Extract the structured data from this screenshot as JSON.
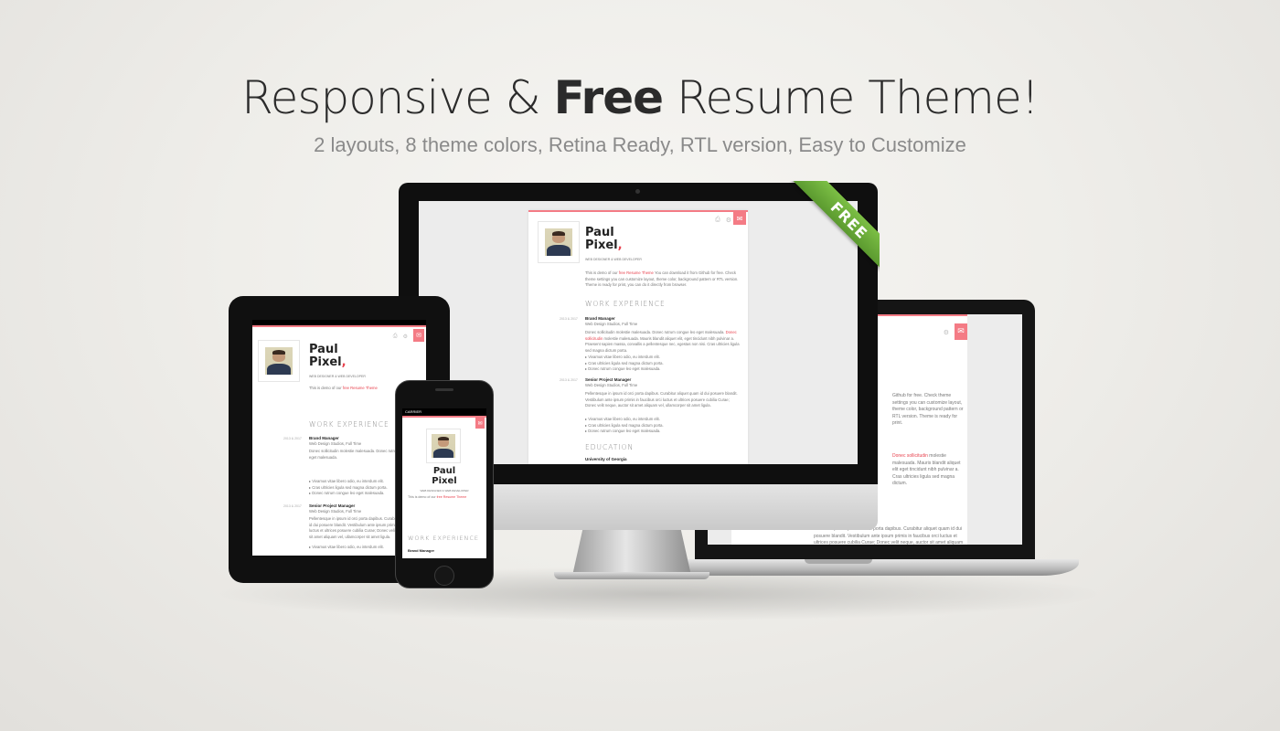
{
  "header": {
    "headline_pre": "Responsive &",
    "headline_bold": "Free",
    "headline_post": "Resume Theme!",
    "subline": "2 layouts, 8 theme colors, Retina Ready, RTL version, Easy to Customize"
  },
  "badge": {
    "text": "FREE",
    "color": "#6aa83a"
  },
  "accent_color": "#e8434f",
  "resume": {
    "name_first": "Paul",
    "name_last": "Pixel",
    "comma": ",",
    "role": "WEB DESIGNER & WEB DEVELOPER",
    "intro_pre": "This is demo of our",
    "intro_link": "free Resume Theme",
    "intro_post": "You can download it from Github for free. Check theme settings you can customize layout, theme color, background pattern or RTL version. Theme is ready for print, you can do it directly from browser.",
    "work_title": "WORK EXPERIENCE",
    "education_title": "EDUCATION",
    "jobs": [
      {
        "date": "2013 & 2017",
        "title": "Brand Manager",
        "company": "Web Design Studios, Full Time",
        "desc_pre": "Donec sollicitudin molestie malesuada. Donec rutrum congue leo eget malesuada.",
        "desc_link": "Donec sollicitudin",
        "desc_post": "molestie malesuada. Mauris blandit aliquet elit, eget tincidunt nibh pulvinar a. Praesent sapien massa, convallis a pellentesque nec, egestas non nisi. Cras ultricies ligula sed magna dictum porta.",
        "bullets": [
          "Vivamus vitae libero odio, eu interdum elit.",
          "Cras ultricies ligula sed magna dictum porta.",
          "Donec rutrum congue leo eget malesuada."
        ]
      },
      {
        "date": "2013 & 2017",
        "title": "Senior Project Manager",
        "company": "Web Design Studios, Full Time",
        "desc_pre": "Pellentesque in ipsum id orci porta dapibus. Curabitur aliquet quam id dui posuere blandit. Vestibulum ante ipsum primis in faucibus orci luctus et ultrices posuere cubilia Curae; Donec velit neque, auctor sit amet aliquam vel, ullamcorper sit amet ligula.",
        "desc_link": "",
        "desc_post": "",
        "bullets": [
          "Vivamus vitae libero odio, eu interdum elit.",
          "Cras ultricies ligula sed magna dictum porta.",
          "Donec rutrum congue leo eget malesuada."
        ]
      }
    ],
    "school": "University of Georgia"
  },
  "phone": {
    "carrier": "CARRIER"
  }
}
